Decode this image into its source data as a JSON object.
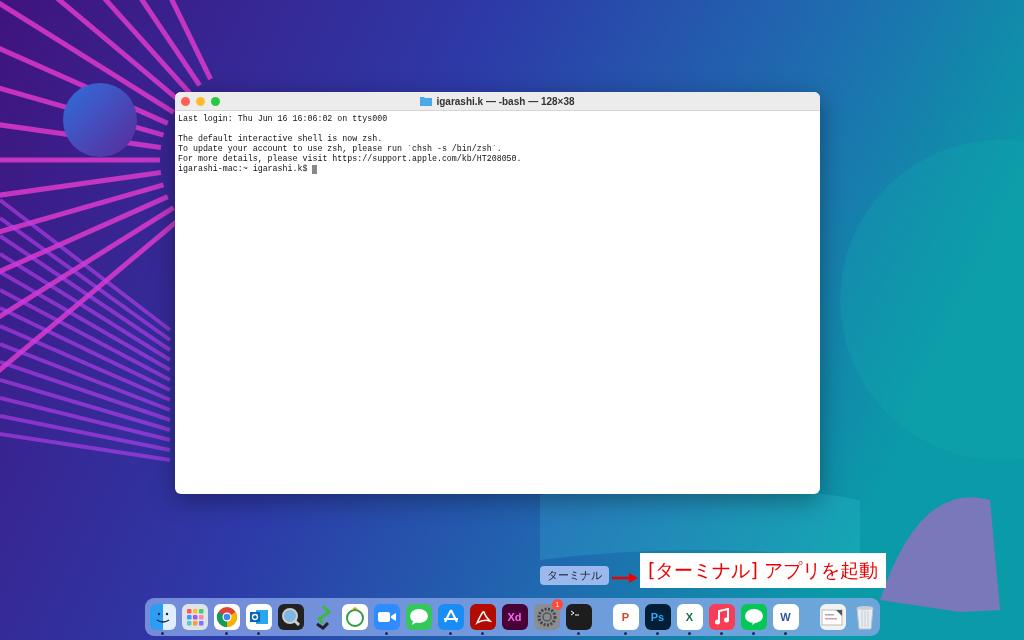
{
  "terminal": {
    "title": "igarashi.k — -bash — 128×38",
    "blocks": [
      [
        "Last login: Thu Jun 16 16:06:02 on ttys000"
      ],
      [
        "The default interactive shell is now zsh.",
        "To update your account to use zsh, please run `chsh -s /bin/zsh`.",
        "For more details, please visit https://support.apple.com/kb/HT208050."
      ]
    ],
    "prompt": "igarashi-mac:~ igarashi.k$",
    "cursor": true
  },
  "callout": {
    "tooltip": "ターミナル",
    "text": "[ターミナル] アプリを起動"
  },
  "dock": {
    "groups": [
      [
        {
          "kind": "finder",
          "running": true
        },
        {
          "kind": "launchpad",
          "running": false
        },
        {
          "kind": "chrome",
          "running": true
        },
        {
          "kind": "outlook",
          "running": true
        },
        {
          "kind": "quicktime",
          "running": false
        },
        {
          "kind": "hook",
          "running": false
        },
        {
          "kind": "recorder",
          "running": false
        },
        {
          "kind": "zoom",
          "running": true
        },
        {
          "kind": "messages",
          "running": false
        },
        {
          "kind": "appstore",
          "running": true
        },
        {
          "kind": "acrobat",
          "running": true
        },
        {
          "kind": "xd",
          "label": "Xd",
          "running": false
        },
        {
          "kind": "settings",
          "running": false,
          "badge": "1"
        },
        {
          "kind": "terminal",
          "running": true
        }
      ],
      [
        {
          "kind": "powerpoint",
          "label": "P",
          "running": true
        },
        {
          "kind": "photoshop",
          "label": "Ps",
          "running": true
        },
        {
          "kind": "excel",
          "label": "X",
          "running": true
        },
        {
          "kind": "music",
          "running": true
        },
        {
          "kind": "line",
          "running": true
        },
        {
          "kind": "word",
          "label": "W",
          "running": true
        }
      ],
      [
        {
          "kind": "document",
          "running": false
        },
        {
          "kind": "trash",
          "running": false
        }
      ]
    ]
  }
}
